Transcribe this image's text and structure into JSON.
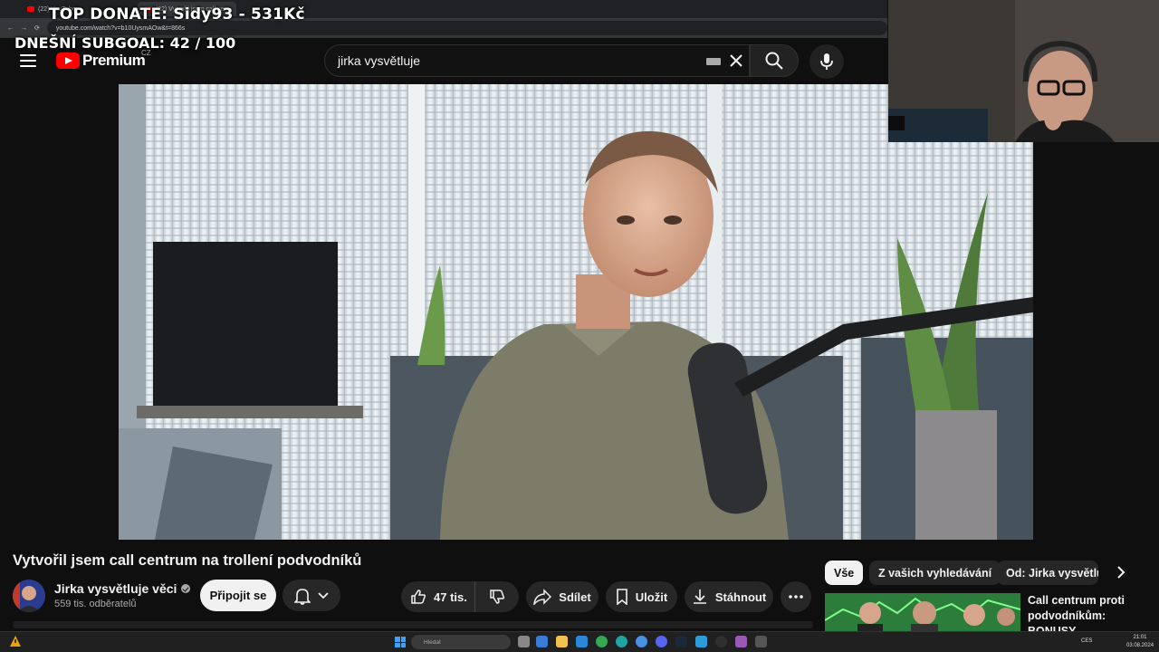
{
  "browser": {
    "tab1_label": "(22) YouTube",
    "tab2_label": "(22) Vytvořil jsem call ce...",
    "url": "youtube.com/watch?v=b10UysmAOw&t=866s"
  },
  "stream_overlay": {
    "top_donate": "TOP DONATE: Sidy93 - 531Kč",
    "subgoal": "DNEŠNÍ SUBGOAL: 42 / 100"
  },
  "masthead": {
    "logo_text": "Premium",
    "country_code": "CZ",
    "search_value": "jirka vysvětluje"
  },
  "video": {
    "title": "Vytvořil jsem call centrum na trollení podvodníků",
    "channel_name": "Jirka vysvětluje věci",
    "subscribers": "559 tis. odběratelů",
    "join_label": "Připojit se",
    "likes": "47 tis.",
    "share_label": "Sdílet",
    "save_label": "Uložit",
    "download_label": "Stáhnout"
  },
  "chips": {
    "all": "Vše",
    "from_searches": "Z vašich vyhledávání",
    "from_channel": "Od: Jirka vysvětluje"
  },
  "related": {
    "title": "Call centrum proti podvodníkům: BONUSY"
  },
  "taskbar": {
    "search_placeholder": "Hledat",
    "lang": "CES",
    "time": "21:01",
    "date": "03.08.2024"
  },
  "colors": {
    "background": "#0f0f0f",
    "brand_red": "#ff0000",
    "pill_bg": "#272727",
    "text_primary": "#f1f1f1",
    "text_secondary": "#aaaaaa"
  },
  "icons": [
    "menu-icon",
    "youtube-logo-icon",
    "keyboard-icon",
    "clear-icon",
    "search-icon",
    "mic-icon",
    "verified-icon",
    "bell-icon",
    "chevron-down-icon",
    "like-icon",
    "dislike-icon",
    "share-icon",
    "bookmark-icon",
    "download-icon",
    "more-icon",
    "chevron-right-icon",
    "windows-icon"
  ]
}
